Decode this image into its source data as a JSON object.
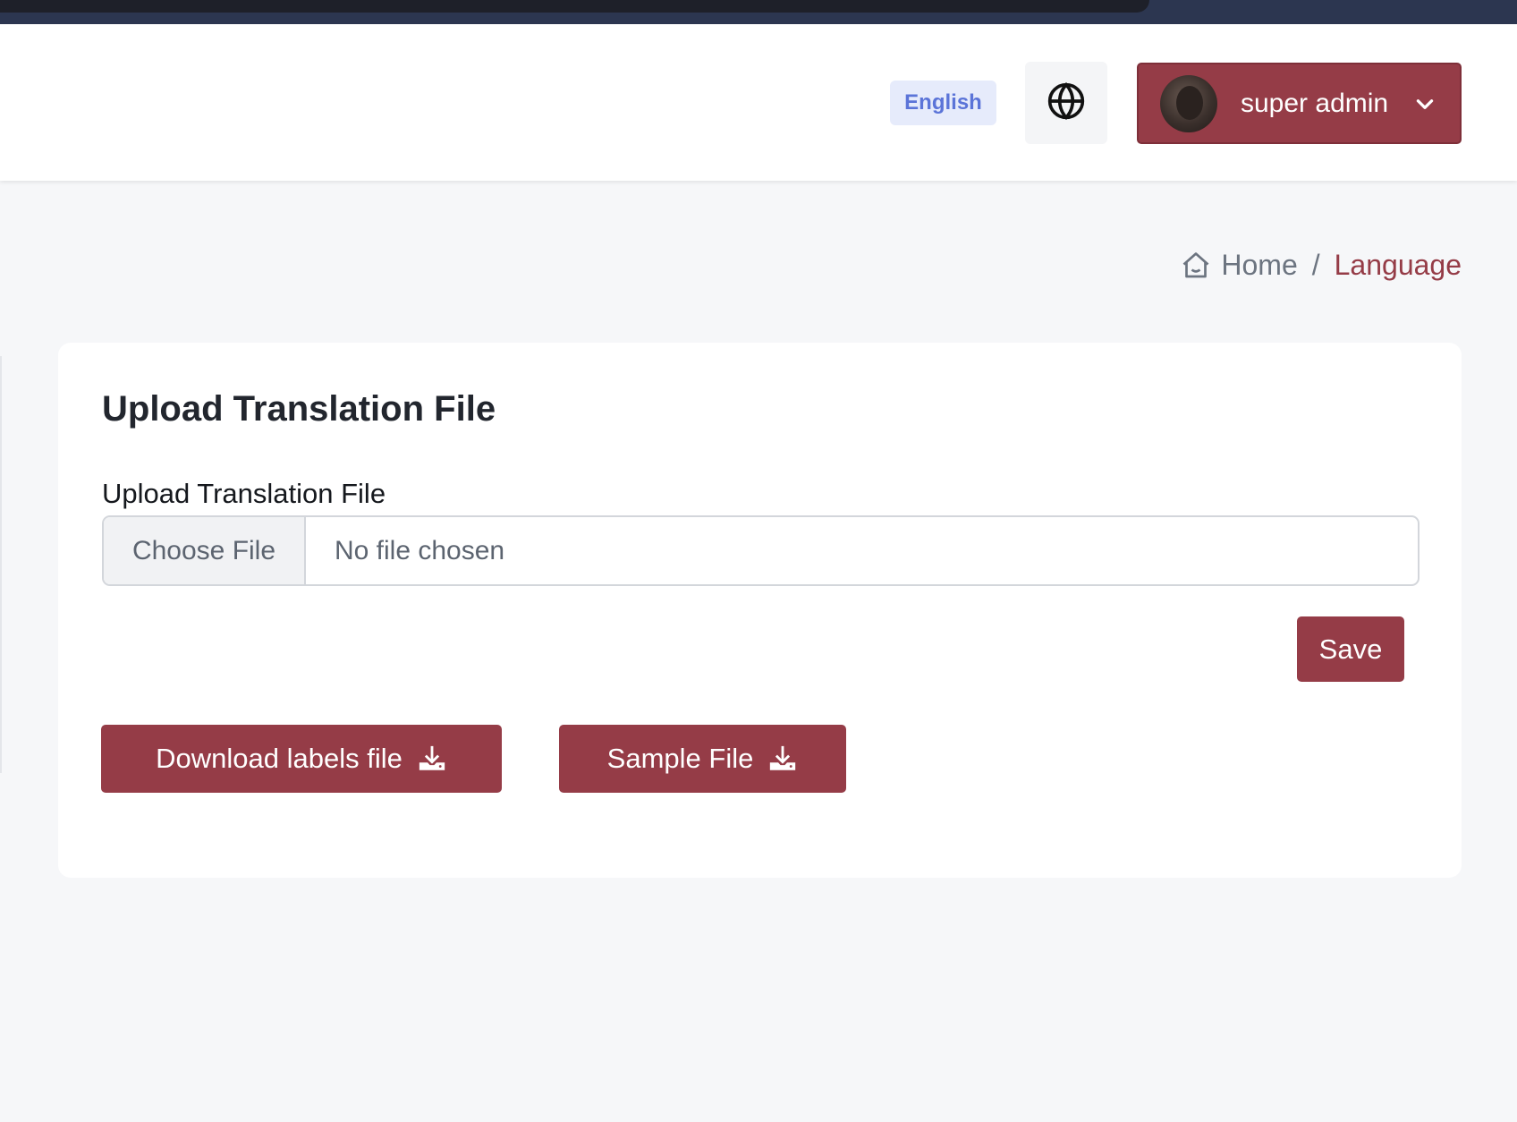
{
  "header": {
    "language_badge": "English",
    "globe_icon": "globe-icon",
    "user": {
      "name": "super admin",
      "avatar_icon": "avatar",
      "dropdown_icon": "chevron-down-icon"
    }
  },
  "breadcrumb": {
    "home_icon": "home-icon",
    "home": "Home",
    "separator": "/",
    "current": "Language"
  },
  "card": {
    "title": "Upload Translation File",
    "field_label": "Upload Translation File",
    "file_input": {
      "button_label": "Choose File",
      "status": "No file chosen"
    },
    "save_label": "Save",
    "download_labels": "Download labels file",
    "sample_file": "Sample File",
    "download_icon": "download-icon"
  },
  "colors": {
    "primary": "#953c47",
    "badge_bg": "#e6ebfb",
    "badge_text": "#5b74d8",
    "page_bg": "#f6f7f9"
  }
}
